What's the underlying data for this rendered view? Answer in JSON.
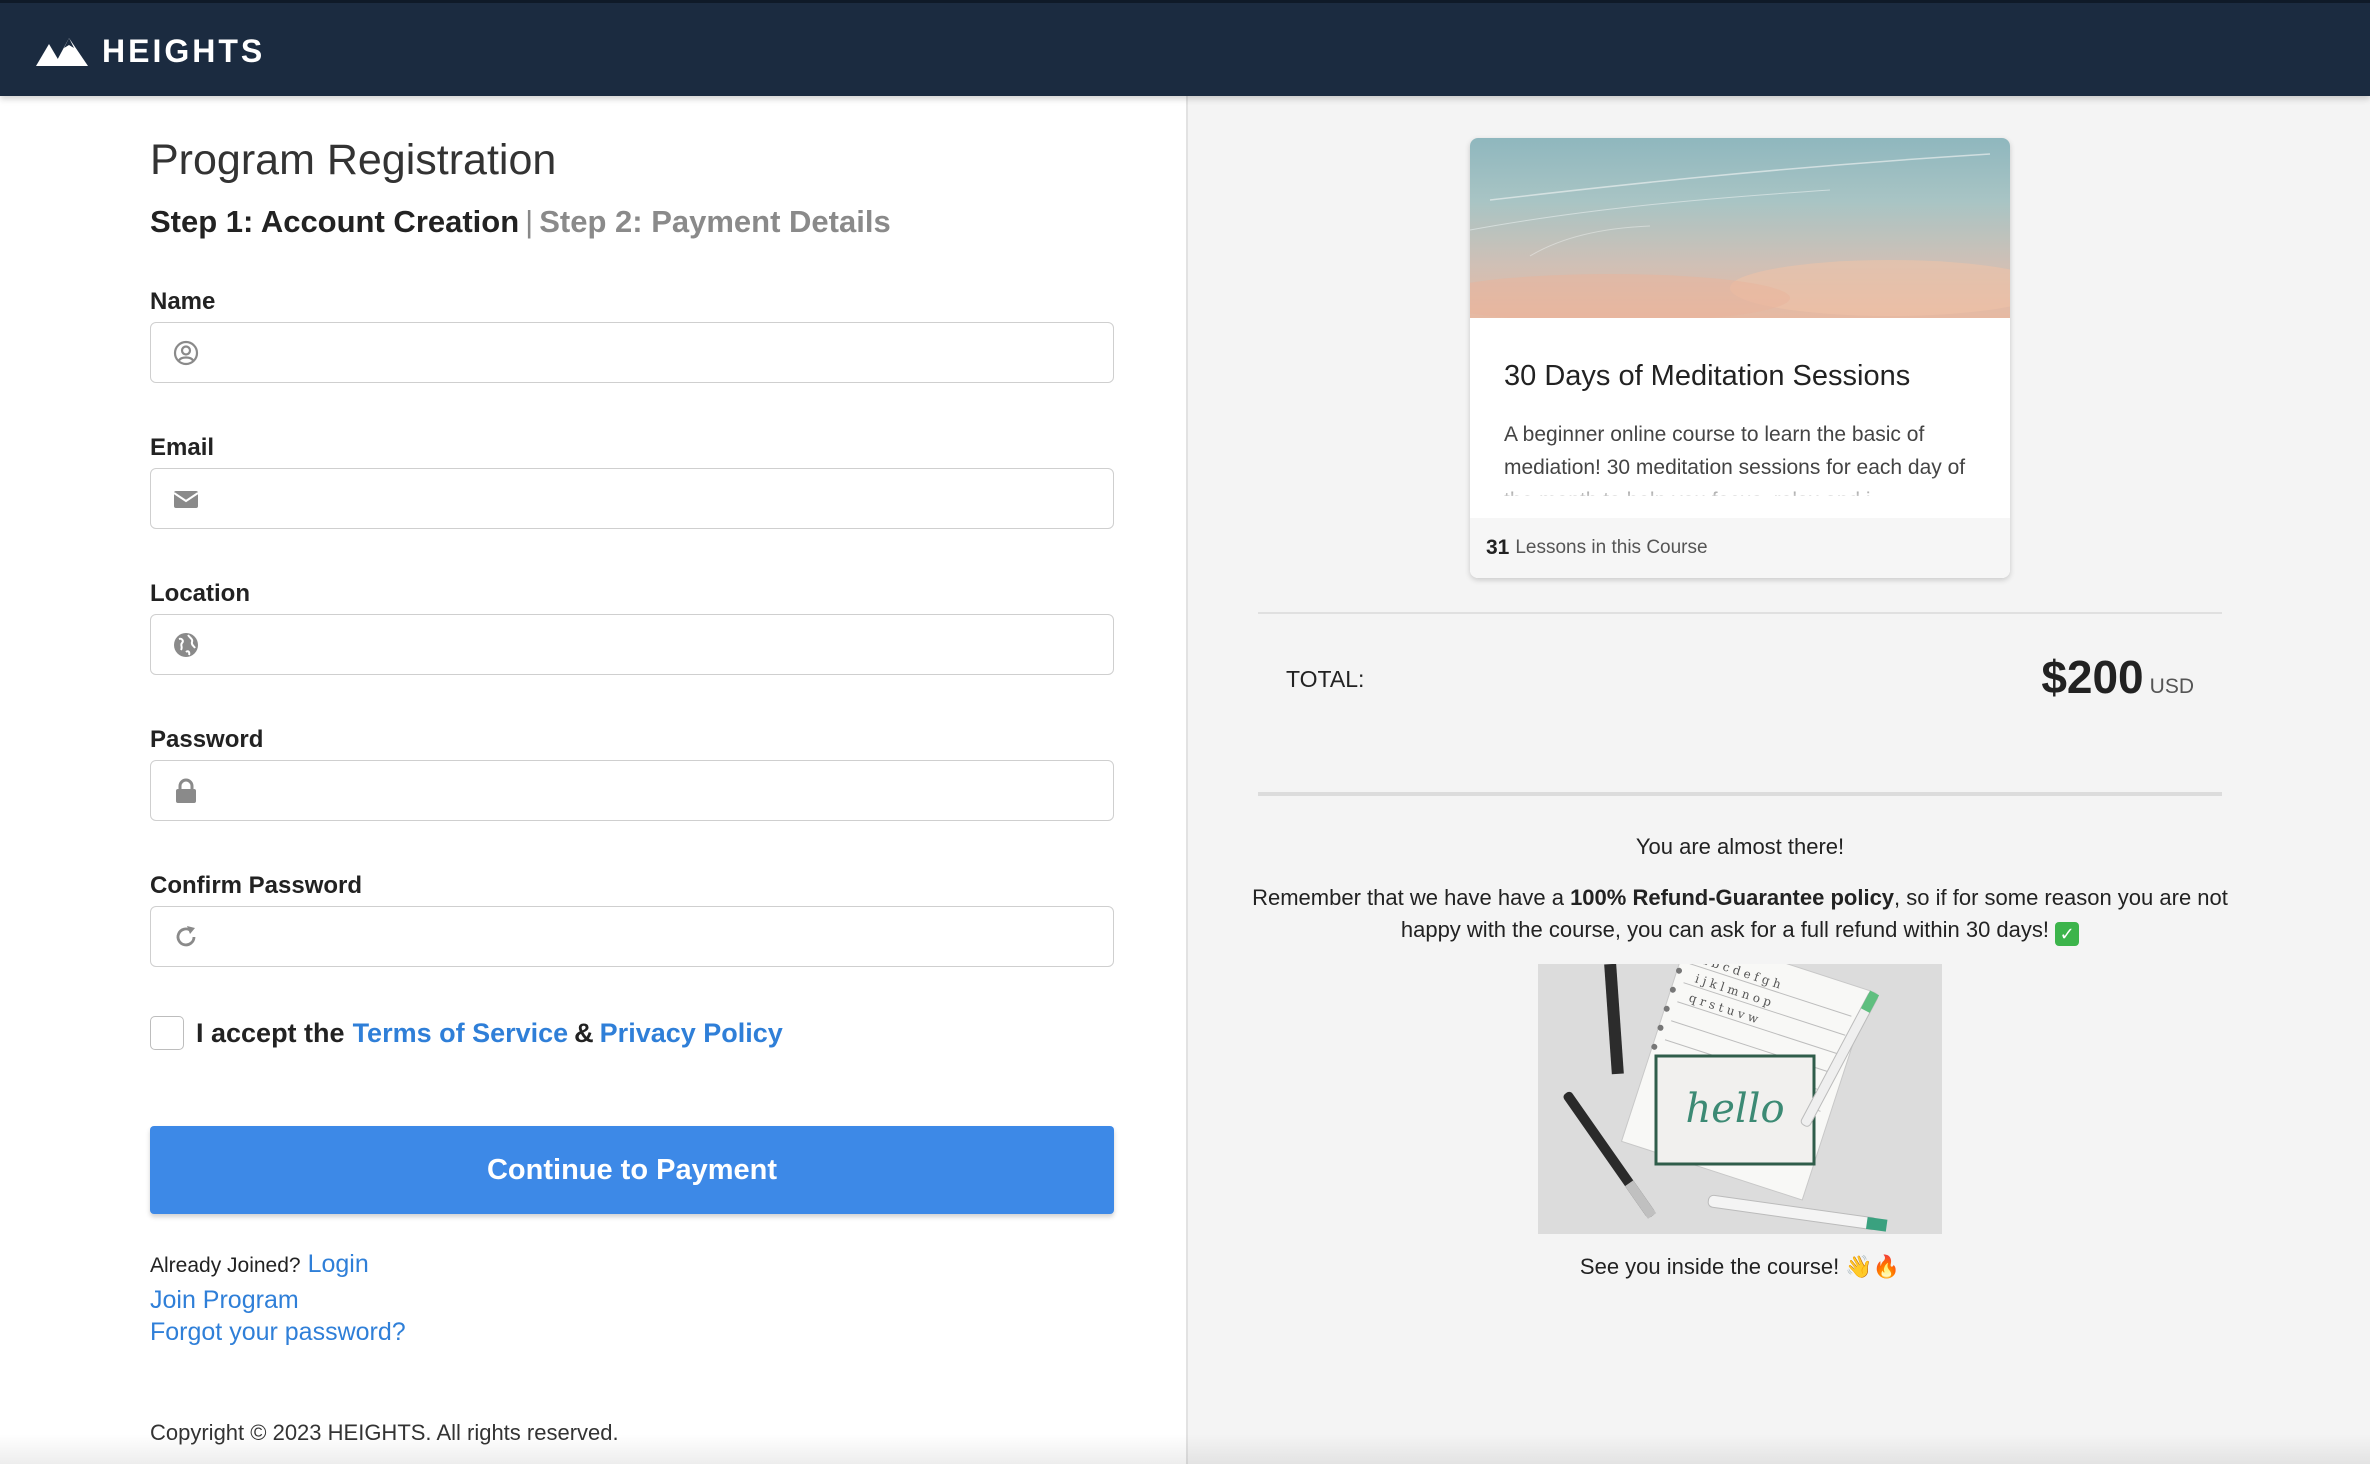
{
  "header": {
    "brand": "HEIGHTS",
    "logo_icon": "mountains-icon",
    "background": "#1b2b40"
  },
  "registration": {
    "title": "Program Registration",
    "step_active": "Step 1: Account Creation",
    "step_separator": "|",
    "step_inactive": "Step 2: Payment Details",
    "fields": [
      {
        "label": "Name",
        "icon": "user-circle-icon",
        "value": "",
        "placeholder": ""
      },
      {
        "label": "Email",
        "icon": "envelope-icon",
        "value": "",
        "placeholder": ""
      },
      {
        "label": "Location",
        "icon": "globe-icon",
        "value": "",
        "placeholder": ""
      },
      {
        "label": "Password",
        "icon": "lock-icon",
        "value": "",
        "placeholder": ""
      },
      {
        "label": "Confirm Password",
        "icon": "refresh-icon",
        "value": "",
        "placeholder": ""
      }
    ],
    "terms": {
      "prefix": "I accept the",
      "tos": "Terms of Service",
      "amp": "&",
      "privacy": "Privacy Policy",
      "checked": false
    },
    "cta_label": "Continue to Payment",
    "cta_color": "#3d89e7",
    "already_joined": "Already Joined?",
    "login": "Login",
    "join_program": "Join Program",
    "forgot": "Forgot your password?",
    "copyright": "Copyright © 2023 HEIGHTS. All rights reserved."
  },
  "summary": {
    "course": {
      "title": "30 Days of Meditation Sessions",
      "description": "A beginner online course to learn the basic of mediation! 30 meditation sessions for each day of the month to help you focus, relax and i...",
      "lesson_count": "31",
      "lesson_label": "Lessons in this Course"
    },
    "total_label": "TOTAL:",
    "amount": "$200",
    "currency": "USD",
    "almost_there": "You are almost there!",
    "remember_prefix": "Remember that we have have a ",
    "remember_bold": "100% Refund-Guarantee policy",
    "remember_suffix": ", so if for some reason you are not happy with the course, you can ask for a full refund within 30 days!",
    "check_icon": "check-mark-emoji",
    "hello_image_text": "hello",
    "see_you": "See you inside the course! 👋🔥"
  }
}
